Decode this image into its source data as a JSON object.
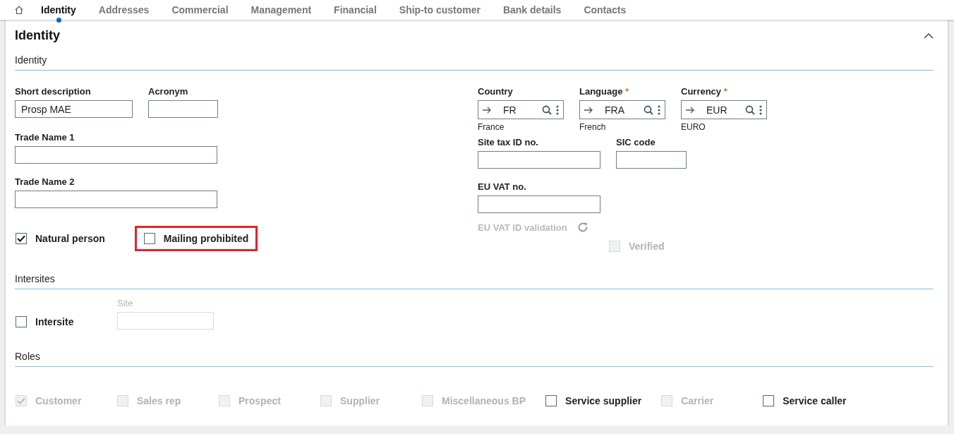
{
  "tabs": [
    {
      "label": "Identity",
      "selected": true
    },
    {
      "label": "Addresses",
      "selected": false
    },
    {
      "label": "Commercial",
      "selected": false
    },
    {
      "label": "Management",
      "selected": false
    },
    {
      "label": "Financial",
      "selected": false
    },
    {
      "label": "Ship-to customer",
      "selected": false
    },
    {
      "label": "Bank details",
      "selected": false
    },
    {
      "label": "Contacts",
      "selected": false
    }
  ],
  "card": {
    "title": "Identity"
  },
  "identity": {
    "title": "Identity",
    "short_description": {
      "label": "Short description",
      "value": "Prosp MAE"
    },
    "acronym": {
      "label": "Acronym"
    },
    "trade_name_1": {
      "label": "Trade Name 1"
    },
    "trade_name_2": {
      "label": "Trade Name 2"
    },
    "checkboxes": [
      {
        "label": "Natural person",
        "checked": true,
        "highlighted": false
      },
      {
        "label": "Mailing prohibited",
        "checked": false,
        "highlighted": true
      }
    ],
    "lookups": [
      {
        "label": "Country",
        "value": "FR",
        "description": "France"
      },
      {
        "label": "Language",
        "required_mark": "*",
        "value": "FRA",
        "description": "French"
      },
      {
        "label": "Currency",
        "required_mark": "*",
        "value": "EUR",
        "description": "EURO"
      }
    ],
    "site_tax_id": {
      "label": "Site tax ID no."
    },
    "sic_code": {
      "label": "SIC code"
    },
    "eu_vat": {
      "label": "EU VAT no."
    },
    "vat_validation": {
      "label": "EU VAT ID validation",
      "disabled": true
    },
    "verified": {
      "label": "Verified",
      "checked": false,
      "disabled": true
    }
  },
  "intersites": {
    "title": "Intersites",
    "intersite": {
      "label": "Intersite",
      "checked": false
    },
    "site": {
      "label": "Site",
      "disabled": true
    }
  },
  "roles": {
    "title": "Roles",
    "items": [
      {
        "label": "Customer",
        "checked": true,
        "disabled": true
      },
      {
        "label": "Sales rep",
        "checked": false,
        "disabled": true
      },
      {
        "label": "Prospect",
        "checked": false,
        "disabled": true
      },
      {
        "label": "Supplier",
        "checked": false,
        "disabled": true
      },
      {
        "label": "Miscellaneous BP",
        "checked": false,
        "disabled": true
      },
      {
        "label": "Service supplier",
        "checked": false,
        "disabled": false
      },
      {
        "label": "Carrier",
        "checked": false,
        "disabled": true
      },
      {
        "label": "Service caller",
        "checked": false,
        "disabled": false
      }
    ]
  }
}
